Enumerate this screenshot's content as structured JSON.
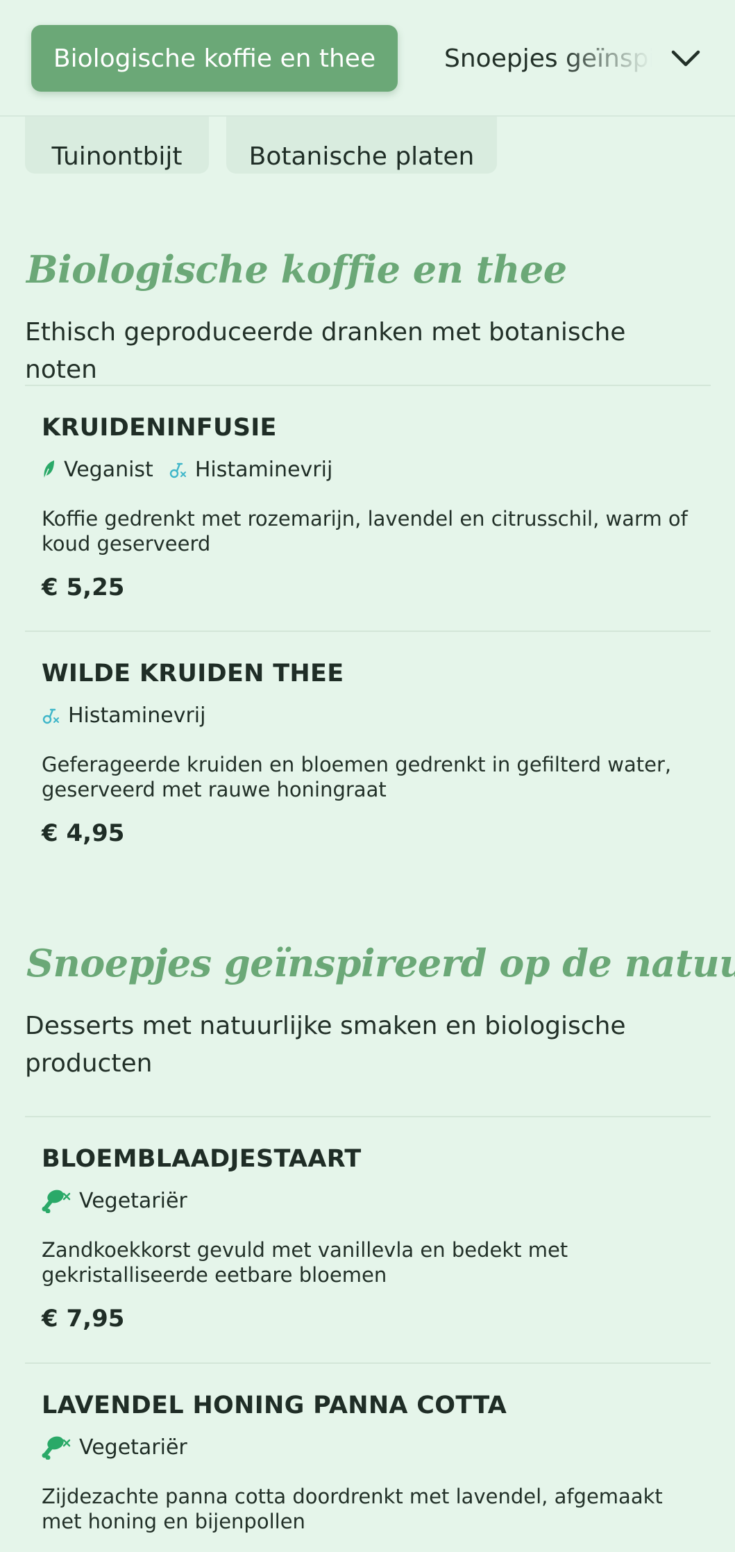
{
  "header": {
    "active_category": "Biologische koffie en thee",
    "next_category": "Snoepjes geïnspireerd op de natuur",
    "chips": [
      "Tuinontbijt",
      "Botanische platen"
    ]
  },
  "sections": [
    {
      "title": "Biologische koffie en thee",
      "description": "Ethisch geproduceerde dranken met botanische noten",
      "items": [
        {
          "name": "KRUIDENINFUSIE",
          "tags": [
            "Veganist",
            "Histaminevrij"
          ],
          "description": "Koffie gedrenkt met rozemarijn, lavendel en citrusschil, warm of koud geserveerd",
          "price": "€ 5,25"
        },
        {
          "name": "WILDE KRUIDEN THEE",
          "tags": [
            "Histaminevrij"
          ],
          "description": "Geferageerde kruiden en bloemen gedrenkt in gefilterd water, geserveerd met rauwe honingraat",
          "price": "€ 4,95"
        }
      ]
    },
    {
      "title": "Snoepjes geïnspireerd op de natuur",
      "description": "Desserts met natuurlijke smaken en biologische producten",
      "items": [
        {
          "name": "BLOEMBLAADJESTAART",
          "tags": [
            "Vegetariër"
          ],
          "description": "Zandkoekkorst gevuld met vanillevla en bedekt met gekristalliseerde eetbare bloemen",
          "price": "€ 7,95"
        },
        {
          "name": "LAVENDEL HONING PANNA COTTA",
          "tags": [
            "Vegetariër"
          ],
          "description": "Zijdezachte panna cotta doordrenkt met lavendel, afgemaakt met honing en bijenpollen"
        }
      ]
    }
  ],
  "icons": {
    "vegan": "leaf-icon",
    "histamine_free": "histamine-free-icon",
    "vegetarian": "drumstick-crossed-icon"
  },
  "colors": {
    "background": "#e5f5ea",
    "accent": "#6ba877",
    "vegan_icon": "#2aa968",
    "histamine_icon": "#3fb6c9",
    "vegetarian_icon": "#2aa968"
  }
}
